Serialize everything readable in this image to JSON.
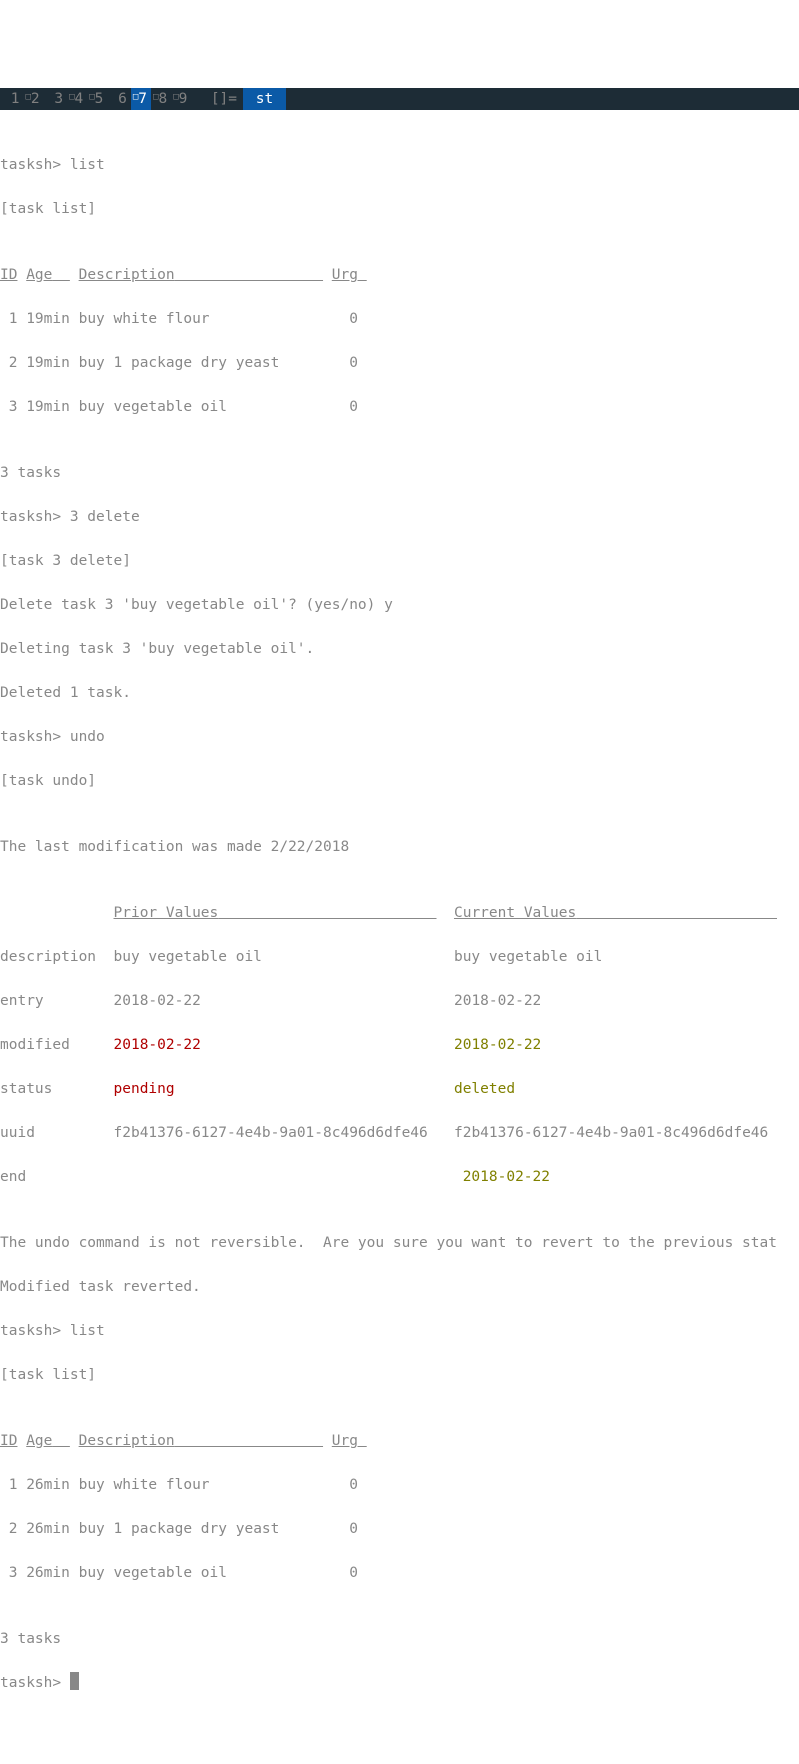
{
  "topbar": {
    "workspaces": [
      {
        "num": "1",
        "sup": ""
      },
      {
        "num": "2",
        "sup": ""
      },
      {
        "num": "3",
        "sup": ""
      },
      {
        "num": "4",
        "sup": ""
      },
      {
        "num": "5",
        "sup": ""
      },
      {
        "num": "6",
        "sup": ""
      },
      {
        "num": "7",
        "sup": "",
        "active": true
      },
      {
        "num": "8",
        "sup": ""
      },
      {
        "num": "9",
        "sup": ""
      }
    ],
    "layout": "[]=",
    "title": "st"
  },
  "prompt1": "tasksh> ",
  "cmd1": "list",
  "echo1": "[task list]",
  "blank": "",
  "table1": {
    "head": {
      "id": "ID",
      "age": "Age",
      "desc": "Description",
      "urg": "Urg"
    },
    "rows": [
      {
        "id": " 1",
        "age": "19min",
        "desc": "buy white flour",
        "urg": "0"
      },
      {
        "id": " 2",
        "age": "19min",
        "desc": "buy 1 package dry yeast",
        "urg": "0"
      },
      {
        "id": " 3",
        "age": "19min",
        "desc": "buy vegetable oil",
        "urg": "0"
      }
    ],
    "summary": "3 tasks"
  },
  "cmd2": "3 delete",
  "echo2": "[task 3 delete]",
  "del1": "Delete task 3 'buy vegetable oil'? (yes/no) y",
  "del2": "Deleting task 3 'buy vegetable oil'.",
  "del3": "Deleted 1 task.",
  "cmd3": "undo",
  "echo3": "[task undo]",
  "undoHeader": "The last modification was made 2/22/2018",
  "undo": {
    "col1": "Prior Values",
    "col2": "Current Values",
    "rows": [
      {
        "label": "description",
        "prior": "buy vegetable oil",
        "current": "buy vegetable oil",
        "priorColor": "",
        "currentColor": ""
      },
      {
        "label": "entry",
        "prior": "2018-02-22",
        "current": "2018-02-22",
        "priorColor": "",
        "currentColor": ""
      },
      {
        "label": "modified",
        "prior": "2018-02-22",
        "current": "2018-02-22",
        "priorColor": "red",
        "currentColor": "olive"
      },
      {
        "label": "status",
        "prior": "pending",
        "current": "deleted",
        "priorColor": "red",
        "currentColor": "olive"
      },
      {
        "label": "uuid",
        "prior": "f2b41376-6127-4e4b-9a01-8c496d6dfe46",
        "current": "f2b41376-6127-4e4b-9a01-8c496d6dfe46",
        "priorColor": "",
        "currentColor": ""
      },
      {
        "label": "end",
        "prior": "",
        "current": "2018-02-22",
        "priorColor": "",
        "currentColor": "olive"
      }
    ]
  },
  "undoWarn": "The undo command is not reversible.  Are you sure you want to revert to the previous stat",
  "undoDone": "Modified task reverted.",
  "cmd4": "list",
  "echo4": "[task list]",
  "table2": {
    "head": {
      "id": "ID",
      "age": "Age",
      "desc": "Description",
      "urg": "Urg"
    },
    "rows": [
      {
        "id": " 1",
        "age": "26min",
        "desc": "buy white flour",
        "urg": "0"
      },
      {
        "id": " 2",
        "age": "26min",
        "desc": "buy 1 package dry yeast",
        "urg": "0"
      },
      {
        "id": " 3",
        "age": "26min",
        "desc": "buy vegetable oil",
        "urg": "0"
      }
    ],
    "summary": "3 tasks"
  }
}
